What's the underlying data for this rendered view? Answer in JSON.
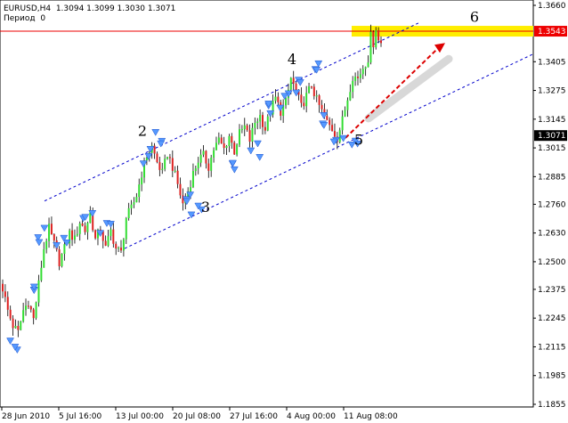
{
  "header": {
    "symbol_line": "EURUSD,H4  1.3094 1.3099 1.3030 1.3071",
    "period_line": "Период  0"
  },
  "colors": {
    "bull": "#33dd33",
    "bear": "#dd2222",
    "wick": "#000000",
    "channel": "#0000cc",
    "arrow": "#dd0000",
    "highlight": "#ffee00",
    "resistance": "#ee0000",
    "fractal": "#5599ff",
    "grid_text": "#000000",
    "price_tag_bg": "#000000",
    "level_tag_bg": "#ee0000"
  },
  "chart_data": {
    "type": "candlestick",
    "title": "EURUSD,H4",
    "ylim": [
      1.1842,
      1.366
    ],
    "y_ticks": [
      "1.3660",
      "1.3405",
      "1.3275",
      "1.3145",
      "1.3015",
      "1.2885",
      "1.2760",
      "1.2630",
      "1.2500",
      "1.2375",
      "1.2245",
      "1.2115",
      "1.1985",
      "1.1855"
    ],
    "x_ticks": [
      "28 Jun 2010",
      "5 Jul 16:00",
      "13 Jul 00:00",
      "20 Jul 08:00",
      "27 Jul 16:00",
      "4 Aug 00:00",
      "11 Aug 08:00"
    ],
    "last_price": "1.3071",
    "resistance_level": "1.3543",
    "wave_labels": [
      {
        "label": "2",
        "value": 1.307
      },
      {
        "label": "3",
        "value": 1.2725
      },
      {
        "label": "4",
        "value": 1.3395
      },
      {
        "label": "5",
        "value": 1.303
      },
      {
        "label": "6",
        "value": 1.3585
      }
    ],
    "close_path": [
      [
        0,
        1.238
      ],
      [
        2,
        1.228
      ],
      [
        4,
        1.221
      ],
      [
        6,
        1.218
      ],
      [
        8,
        1.228
      ],
      [
        10,
        1.232
      ],
      [
        12,
        1.224
      ],
      [
        14,
        1.24
      ],
      [
        16,
        1.256
      ],
      [
        18,
        1.265
      ],
      [
        20,
        1.258
      ],
      [
        22,
        1.25
      ],
      [
        24,
        1.256
      ],
      [
        26,
        1.263
      ],
      [
        28,
        1.26
      ],
      [
        30,
        1.268
      ],
      [
        32,
        1.264
      ],
      [
        34,
        1.272
      ],
      [
        36,
        1.26
      ],
      [
        38,
        1.265
      ],
      [
        40,
        1.256
      ],
      [
        42,
        1.264
      ],
      [
        44,
        1.256
      ],
      [
        46,
        1.254
      ],
      [
        48,
        1.27
      ],
      [
        50,
        1.274
      ],
      [
        52,
        1.28
      ],
      [
        54,
        1.29
      ],
      [
        56,
        1.298
      ],
      [
        58,
        1.302
      ],
      [
        60,
        1.295
      ],
      [
        62,
        1.29
      ],
      [
        64,
        1.299
      ],
      [
        66,
        1.293
      ],
      [
        68,
        1.285
      ],
      [
        70,
        1.276
      ],
      [
        72,
        1.282
      ],
      [
        74,
        1.29
      ],
      [
        76,
        1.296
      ],
      [
        78,
        1.298
      ],
      [
        80,
        1.293
      ],
      [
        82,
        1.301
      ],
      [
        84,
        1.305
      ],
      [
        86,
        1.301
      ],
      [
        88,
        1.307
      ],
      [
        90,
        1.3
      ],
      [
        92,
        1.308
      ],
      [
        94,
        1.311
      ],
      [
        96,
        1.305
      ],
      [
        98,
        1.313
      ],
      [
        100,
        1.316
      ],
      [
        102,
        1.31
      ],
      [
        104,
        1.318
      ],
      [
        106,
        1.324
      ],
      [
        108,
        1.318
      ],
      [
        110,
        1.322
      ],
      [
        112,
        1.333
      ],
      [
        114,
        1.327
      ],
      [
        116,
        1.32
      ],
      [
        118,
        1.325
      ],
      [
        120,
        1.33
      ],
      [
        122,
        1.323
      ],
      [
        124,
        1.318
      ],
      [
        126,
        1.313
      ],
      [
        128,
        1.31
      ],
      [
        130,
        1.306
      ],
      [
        132,
        1.314
      ],
      [
        134,
        1.324
      ],
      [
        136,
        1.334
      ],
      [
        138,
        1.333
      ],
      [
        140,
        1.338
      ],
      [
        142,
        1.342
      ],
      [
        143,
        1.352
      ],
      [
        144,
        1.349
      ],
      [
        145,
        1.356
      ],
      [
        146,
        1.35
      ],
      [
        147,
        1.349
      ]
    ]
  },
  "fractal_anchor_values": [
    1.212,
    1.238,
    1.262,
    1.258,
    1.272,
    1.266,
    1.298,
    1.307,
    1.278,
    1.272,
    1.295,
    1.301,
    1.32,
    1.323,
    1.33,
    1.34,
    1.315,
    1.306,
    1.304
  ]
}
